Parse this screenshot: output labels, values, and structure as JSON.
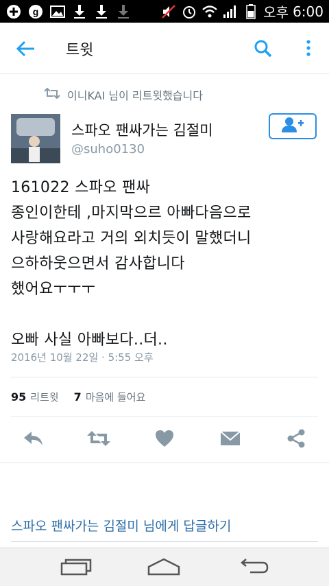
{
  "status_bar": {
    "period": "오후",
    "time": "6:00"
  },
  "header": {
    "title": "트윗"
  },
  "retweet": {
    "text": "이니KAI 님이 리트윗했습니다"
  },
  "author": {
    "name": "스파오 팬싸가는 김절미",
    "handle": "@suho0130"
  },
  "tweet": {
    "text": "161022  스파오 팬싸\n종인이한테 ,마지막으르 아빠다음으로\n사랑해요라고 거의 외치듯이 말했더니\n으하하웃으면서 감사합니다\n했어요ㅜㅜㅜ\n\n오빠 사실 아빠보다..더..",
    "timestamp": "2016년 10월 22일 · 5:55 오후"
  },
  "stats": {
    "retweets_count": "95",
    "retweets_label": "리트윗",
    "likes_count": "7",
    "likes_label": "마음에 들어요"
  },
  "reply": {
    "placeholder": "스파오 팬싸가는 김절미 님에게 답글하기"
  },
  "colors": {
    "accent": "#1da1f2",
    "action_gray": "#8899a6"
  }
}
